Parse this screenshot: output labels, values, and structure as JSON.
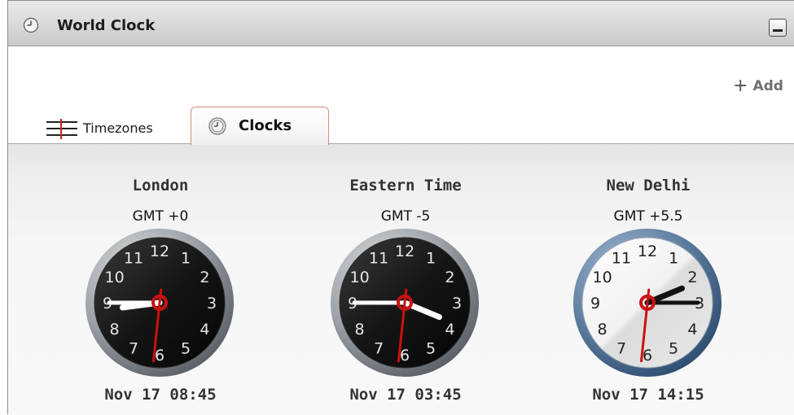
{
  "window": {
    "title": "World Clock",
    "icon": "clock-icon",
    "minimize": "minimize-icon"
  },
  "toolbar": {
    "add_label": "Add",
    "add_icon": "plus-icon"
  },
  "tabs": [
    {
      "label": "Timezones",
      "icon": "list-icon",
      "active": false
    },
    {
      "label": "Clocks",
      "icon": "clock-icon",
      "active": true
    }
  ],
  "clocks": [
    {
      "city": "London",
      "offset": "GMT +0",
      "datetime": "Nov 17 08:45",
      "hour": 8,
      "minute": 45,
      "second": 31,
      "theme": "dark"
    },
    {
      "city": "Eastern Time",
      "offset": "GMT -5",
      "datetime": "Nov 17 03:45",
      "hour": 3,
      "minute": 45,
      "second": 31,
      "theme": "dark"
    },
    {
      "city": "New Delhi",
      "offset": "GMT +5.5",
      "datetime": "Nov 17 14:15",
      "hour": 14,
      "minute": 15,
      "second": 31,
      "theme": "light"
    }
  ],
  "colors": {
    "second_hand": "#cc1111",
    "tab_border": "#d98b84"
  }
}
